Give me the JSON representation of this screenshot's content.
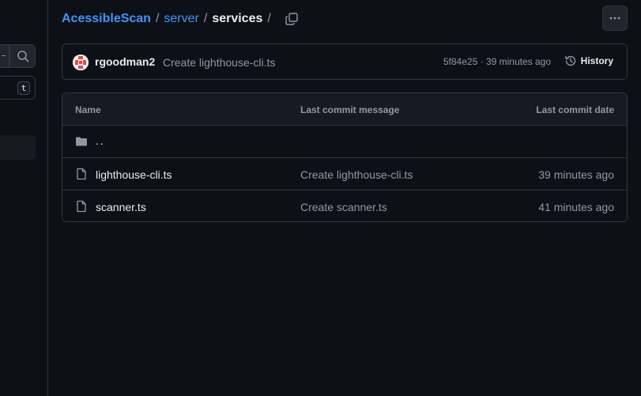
{
  "breadcrumb": {
    "repo": "AcessibleScan",
    "folder": "server",
    "current": "services",
    "separator": "/"
  },
  "sidebar": {
    "filter_shortcut": "t"
  },
  "commit": {
    "author": "rgoodman2",
    "message": "Create lighthouse-cli.ts",
    "hash": "5f84e25",
    "dot": "·",
    "time": "39 minutes ago",
    "history_label": "History"
  },
  "table": {
    "headers": {
      "name": "Name",
      "message": "Last commit message",
      "date": "Last commit date"
    },
    "parent_label": "..",
    "rows": [
      {
        "name": "lighthouse-cli.ts",
        "message": "Create lighthouse-cli.ts",
        "date": "39 minutes ago"
      },
      {
        "name": "scanner.ts",
        "message": "Create scanner.ts",
        "date": "41 minutes ago"
      }
    ]
  },
  "colors": {
    "background": "#0d1117",
    "link": "#4493f8",
    "muted": "#9198a1",
    "border": "#30363d"
  }
}
